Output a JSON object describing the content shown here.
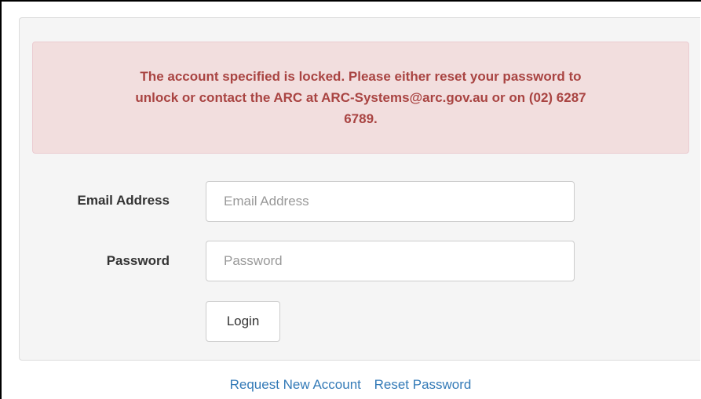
{
  "alert": {
    "lines": [
      "The account specified is locked. Please either reset your password to",
      "unlock or contact the ARC at ARC-Systems@arc.gov.au or on (02) 6287",
      "6789."
    ]
  },
  "form": {
    "email_label": "Email Address",
    "email_placeholder": "Email Address",
    "password_label": "Password",
    "password_placeholder": "Password",
    "login_label": "Login"
  },
  "footer": {
    "request_account_label": "Request New Account",
    "reset_password_label": "Reset Password"
  },
  "colors": {
    "alert_bg": "#f2dede",
    "alert_text": "#a94442",
    "panel_bg": "#f5f5f5",
    "link": "#337ab7"
  }
}
